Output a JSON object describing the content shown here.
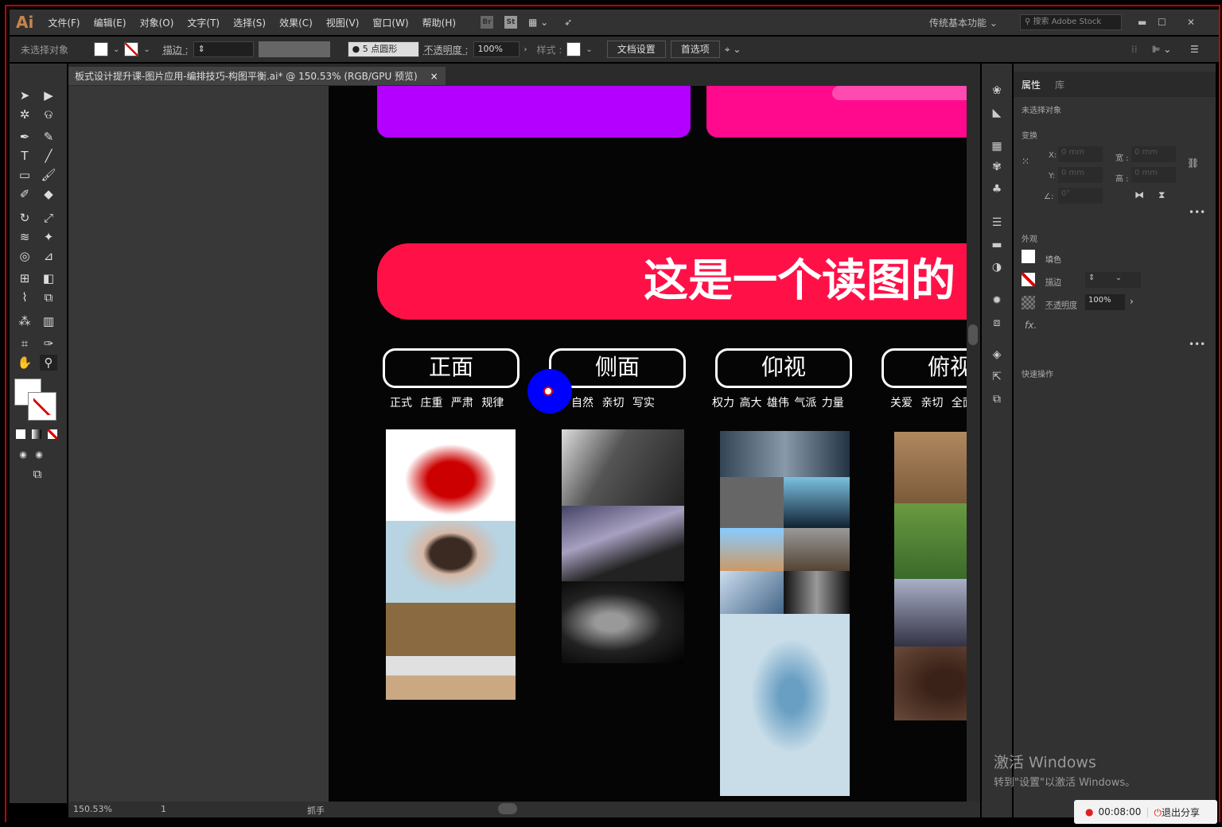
{
  "app": {
    "logo": "Ai",
    "menu": [
      "文件(F)",
      "编辑(E)",
      "对象(O)",
      "文字(T)",
      "选择(S)",
      "效果(C)",
      "视图(V)",
      "窗口(W)",
      "帮助(H)"
    ],
    "bridge": "Br",
    "stock": "St",
    "workspace": "传统基本功能",
    "search_placeholder": "搜索 Adobe Stock"
  },
  "control": {
    "selection": "未选择对象",
    "stroke_label": "描边 :",
    "brush": "5 点圆形",
    "opacity_label": "不透明度 :",
    "opacity": "100%",
    "style_label": "样式 :",
    "doc_setup": "文档设置",
    "prefs": "首选项"
  },
  "document": {
    "tab_title": "板式设计提升课-图片应用-编排技巧-构图平衡.ai* @ 150.53% (RGB/GPU 预览)",
    "close": "×"
  },
  "artboard": {
    "banner": "这是一个读图的",
    "colors": {
      "purple": "#b400ff",
      "pink": "#ff0a8c",
      "red": "#ff1148"
    },
    "categories": [
      {
        "title": "正面",
        "keywords": "正式 庄重 严肃 规律"
      },
      {
        "title": "侧面",
        "keywords": "自然 亲切 写实"
      },
      {
        "title": "仰视",
        "keywords": "权力 高大 雄伟 气派 力量"
      },
      {
        "title": "俯视",
        "keywords": "关爱 亲切 全面"
      }
    ]
  },
  "status": {
    "zoom": "150.53%",
    "page": "1",
    "tool": "抓手"
  },
  "properties": {
    "tabs": [
      "属性",
      "库"
    ],
    "selection": "未选择对象",
    "transform": "变换",
    "x_label": "X:",
    "y_label": "Y:",
    "w_label": "宽 :",
    "h_label": "高 :",
    "x": "0 mm",
    "y": "0 mm",
    "w": "0 mm",
    "h": "0 mm",
    "angle": "0°",
    "appearance": "外观",
    "fill": "填色",
    "stroke": "描边",
    "opacity_label": "不透明度",
    "opacity": "100%",
    "fx": "fx.",
    "quick_actions": "快速操作"
  },
  "watermark": {
    "line1": "激活 Windows",
    "line2": "转到\"设置\"以激活 Windows。"
  },
  "recording": {
    "time": "00:08:00",
    "exit": "退出分享"
  }
}
